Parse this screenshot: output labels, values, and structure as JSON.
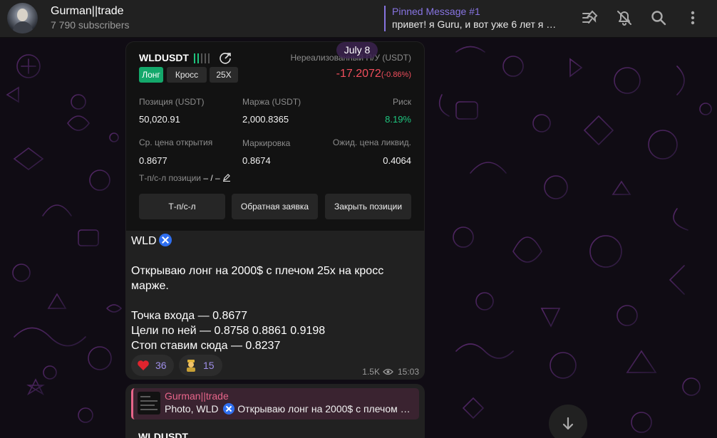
{
  "header": {
    "title": "Gurman||trade",
    "subscribers": "7 790 subscribers",
    "pinned_title": "Pinned Message #1",
    "pinned_text": "привет! я Guru, и вот уже 6 лет я …"
  },
  "chat": {
    "date": "July 8"
  },
  "trade_card": {
    "pair": "WLDUSDT",
    "tag_long": "Лонг",
    "tag_cross": "Кросс",
    "tag_leverage": "25X",
    "pnl_label": "Нереализованный П/У (USDT)",
    "pnl_value": "-17.2072",
    "pnl_pct": "(-0.86%)",
    "position_label": "Позиция (USDT)",
    "position_value": "50,020.91",
    "margin_label": "Маржа (USDT)",
    "margin_value": "2,000.8365",
    "risk_label": "Риск",
    "risk_value": "8.19%",
    "entry_label": "Ср. цена открытия",
    "entry_value": "0.8677",
    "mark_label": "Маркировка",
    "mark_value": "0.8674",
    "liq_label": "Ожид. цена ликвид.",
    "liq_value": "0.4064",
    "tpsl_label": "Т-п/с-л позиции",
    "tpsl_value": "– / –",
    "btn_tpsl": "Т-п/с-л",
    "btn_reverse": "Обратная заявка",
    "btn_close": "Закрыть позиции",
    "colors": {
      "long": "#14a86b",
      "loss": "#f04e5c",
      "risk": "#1ec47e"
    }
  },
  "message": {
    "ticker": "WLD",
    "line1": "Открываю лонг на 2000$ с плечом 25х на кросс",
    "line2": "марже.",
    "entry": "Точка входа — 0.8677",
    "targets": "Цели по ней — 0.8758 0.8861 0.9198",
    "stop": "Стоп ставим сюда — 0.8237",
    "reaction1_emoji": "heart-icon",
    "reaction1_count": "36",
    "reaction2_emoji": "person-emoji-icon",
    "reaction2_count": "15",
    "views": "1.5K",
    "time": "15:03"
  },
  "forward": {
    "name": "Gurman||trade",
    "text_prefix": "Photo, WLD",
    "text_rest": "Открываю лонг на 2000$ с плечом …",
    "next_pair": "WLDUSDT"
  }
}
